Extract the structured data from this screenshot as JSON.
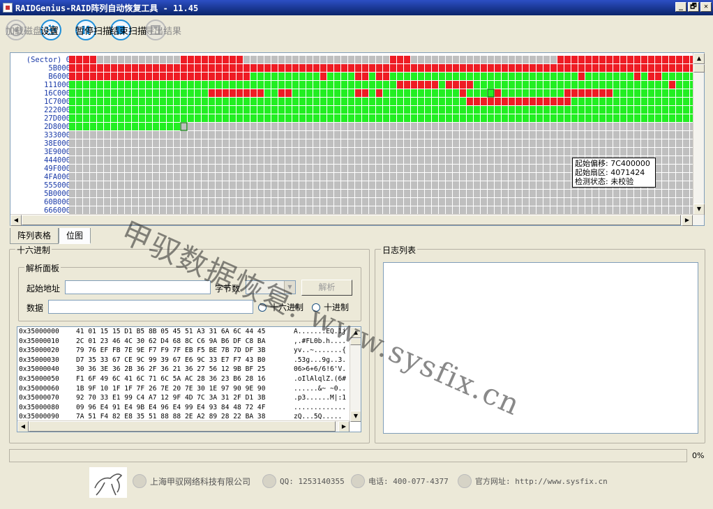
{
  "window": {
    "title": "RAIDGenius-RAID阵列自动恢复工具 - 11.45",
    "controls": [
      "_",
      "🗗",
      "✕"
    ]
  },
  "toolbar": {
    "load_disk": "加载磁盘",
    "settings": "设置",
    "pause_scan": "暂停扫描",
    "stop_scan": "结束扫描",
    "export_result": "导出结果"
  },
  "sector_map": {
    "row_labels": [
      "(Sector)  0",
      "5B000",
      "B6000",
      "111000",
      "16C000",
      "1C7000",
      "222000",
      "27D000",
      "2D8000",
      "333000",
      "38E000",
      "3E9000",
      "444000",
      "49F000",
      "4FA000",
      "555000",
      "5B0000",
      "60B000",
      "666000"
    ],
    "columns": 90,
    "rows": [
      [
        {
          "s": "r",
          "n": 4
        },
        {
          "s": "e",
          "n": 12
        },
        {
          "s": "r",
          "n": 9
        },
        {
          "s": "e",
          "n": 21
        },
        {
          "s": "r",
          "n": 3
        },
        {
          "s": "e",
          "n": 21
        },
        {
          "s": "r",
          "n": 20
        }
      ],
      [
        {
          "s": "r",
          "n": 90
        }
      ],
      [
        {
          "s": "r",
          "n": 26
        },
        {
          "s": "g",
          "n": 10
        },
        {
          "s": "r",
          "n": 1
        },
        {
          "s": "g",
          "n": 4
        },
        {
          "s": "r",
          "n": 2
        },
        {
          "s": "g",
          "n": 1
        },
        {
          "s": "r",
          "n": 2
        },
        {
          "s": "g",
          "n": 27
        },
        {
          "s": "r",
          "n": 1
        },
        {
          "s": "g",
          "n": 7
        },
        {
          "s": "r",
          "n": 1
        },
        {
          "s": "g",
          "n": 1
        },
        {
          "s": "r",
          "n": 2
        },
        {
          "s": "g",
          "n": 6
        }
      ],
      [
        {
          "s": "g",
          "n": 47
        },
        {
          "s": "r",
          "n": 6
        },
        {
          "s": "g",
          "n": 1
        },
        {
          "s": "r",
          "n": 4
        },
        {
          "s": "g",
          "n": 28
        },
        {
          "s": "r",
          "n": 1
        },
        {
          "s": "g",
          "n": 3
        }
      ],
      [
        {
          "s": "g",
          "n": 20
        },
        {
          "s": "r",
          "n": 8
        },
        {
          "s": "g",
          "n": 2
        },
        {
          "s": "r",
          "n": 2
        },
        {
          "s": "g",
          "n": 9
        },
        {
          "s": "r",
          "n": 2
        },
        {
          "s": "g",
          "n": 1
        },
        {
          "s": "r",
          "n": 1
        },
        {
          "s": "g",
          "n": 11
        },
        {
          "s": "r",
          "n": 1
        },
        {
          "s": "g",
          "n": 4
        },
        {
          "s": "r",
          "n": 1
        },
        {
          "s": "g",
          "n": 9
        },
        {
          "s": "r",
          "n": 7
        },
        {
          "s": "g",
          "n": 12
        }
      ],
      [
        {
          "s": "g",
          "n": 57
        },
        {
          "s": "r",
          "n": 15
        },
        {
          "s": "g",
          "n": 18
        }
      ],
      [
        {
          "s": "g",
          "n": 90
        }
      ],
      [
        {
          "s": "g",
          "n": 90
        }
      ],
      [
        {
          "s": "g",
          "n": 16
        },
        {
          "s": "e",
          "n": 74
        }
      ],
      [
        {
          "s": "e",
          "n": 90
        }
      ],
      [
        {
          "s": "e",
          "n": 90
        }
      ],
      [
        {
          "s": "e",
          "n": 90
        }
      ],
      [
        {
          "s": "e",
          "n": 90
        }
      ],
      [
        {
          "s": "e",
          "n": 90
        }
      ],
      [
        {
          "s": "e",
          "n": 90
        }
      ],
      [
        {
          "s": "e",
          "n": 90
        }
      ],
      [
        {
          "s": "e",
          "n": 90
        }
      ],
      [
        {
          "s": "e",
          "n": 90
        }
      ],
      [
        {
          "s": "e",
          "n": 90
        }
      ]
    ],
    "selected_cells": [
      [
        4,
        60
      ],
      [
        8,
        16
      ]
    ],
    "colors": {
      "r": "#EE1C24",
      "g": "#22EE22",
      "e": "#BFBFBF",
      "grid": "#FFFFFF",
      "selected": "#007700"
    },
    "tooltip": {
      "offset_label": "起始偏移:",
      "offset_value": "7C400000",
      "sector_label": "起始扇区:",
      "sector_value": "4071424",
      "status_label": "检测状态:",
      "status_value": "未校验"
    }
  },
  "tabs": [
    "阵列表格",
    "位图"
  ],
  "hex_panel": {
    "title": "十六进制",
    "parse_panel": {
      "title": "解析面板",
      "start_addr_label": "起始地址",
      "start_addr_value": "",
      "byte_count_label": "字节数",
      "parse_button": "解析",
      "data_label": "数据",
      "data_value": "",
      "radio_hex": "十六进制",
      "radio_dec": "十进制"
    },
    "rows": [
      {
        "addr": "0x35000000",
        "bytes": "41 01 15 15 D1 B5 8B 05 45 51 A3 31 6A 6C 44 45",
        "ascii": "A.......EQ.1j"
      },
      {
        "addr": "0x35000010",
        "bytes": "2C 01 23 46 4C 30 62 D4 68 8C C6 9A B6 DF C8 BA",
        "ascii": ",.#FL0b.h...."
      },
      {
        "addr": "0x35000020",
        "bytes": "79 76 EF FB 7E 9E F7 F9 7F EB F5 BE 7B 7D DF 3B",
        "ascii": "yv..~.......{"
      },
      {
        "addr": "0x35000030",
        "bytes": "D7 35 33 67 CE 9C 99 39 67 E6 9C 33 E7 F7 43 B0",
        "ascii": ".53g...9g..3."
      },
      {
        "addr": "0x35000040",
        "bytes": "30 36 3E 36 2B 36 2F 36 21 36 27 56 12 9B BF 25",
        "ascii": "06>6+6/6!6'V."
      },
      {
        "addr": "0x35000050",
        "bytes": "F1 6F 49 6C 41 6C 71 6C 5A AC 28 36 23 B6 28 16",
        "ascii": ".oIlAlqlZ.(6#"
      },
      {
        "addr": "0x35000060",
        "bytes": "1B 9F 10 1F 1F 7F 26 7E 20 7E 30 1E 97 90 9E 90",
        "ascii": "......&~ ~0.."
      },
      {
        "addr": "0x35000070",
        "bytes": "92 70 33 E1 99 C4 A7 12 9F 4D 7C 3A 31 2F D1 3B",
        "ascii": ".p3......M|:1"
      },
      {
        "addr": "0x35000080",
        "bytes": "09 96 E4 91 E4 9B E4 96 E4 99 E4 93 84 48 72 4F",
        "ascii": "............."
      },
      {
        "addr": "0x35000090",
        "bytes": "7A 51 F4 82 E8 35 51 88 88 2E A2 89 28 22 BA 38",
        "ascii": "zQ...5Q....."
      }
    ]
  },
  "log_panel": {
    "title": "日志列表"
  },
  "progress": {
    "value": 0,
    "label": "0%"
  },
  "footer": {
    "company": "上海甲驭网络科技有限公司",
    "qq": "QQ: 1253140355",
    "phone": "电话: 400-077-4377",
    "website": "官方网址: http://www.sysfix.cn"
  },
  "watermark": "甲驭数据恢复: www.sysfix.cn"
}
